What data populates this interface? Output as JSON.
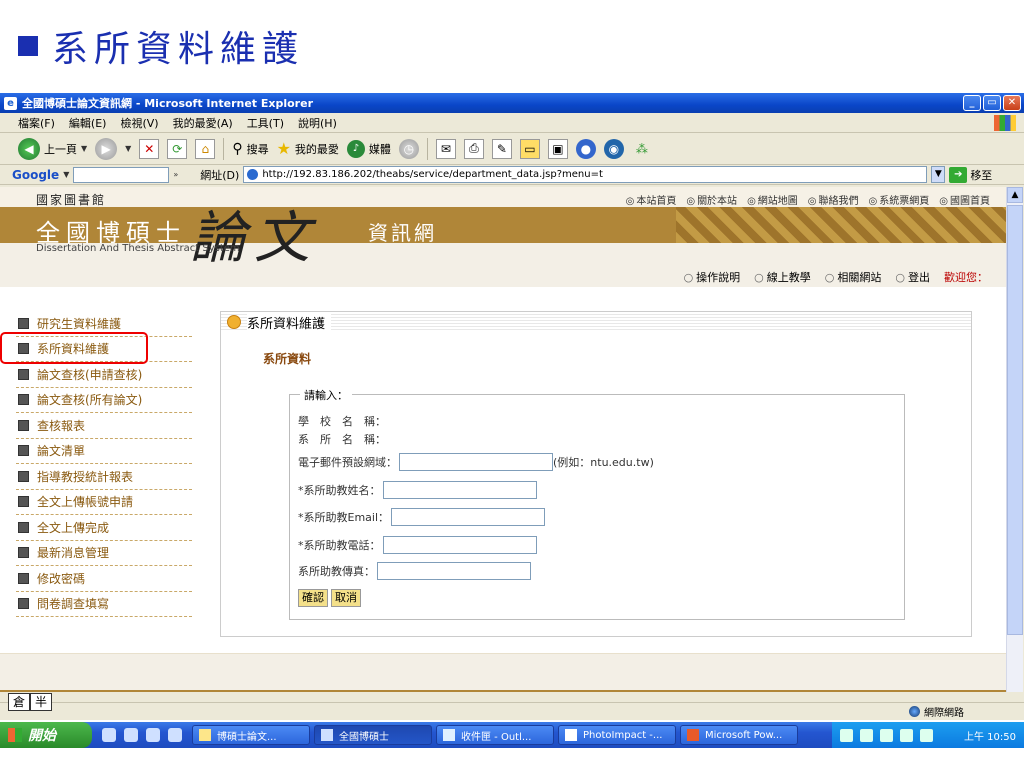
{
  "slide": {
    "title": "系所資料維護"
  },
  "window": {
    "title": "全國博碩士論文資訊網 - Microsoft Internet Explorer",
    "buttons": {
      "minimize": "_",
      "maximize": "▭",
      "close": "✕"
    }
  },
  "menubar": [
    "檔案(F)",
    "編輯(E)",
    "檢視(V)",
    "我的最愛(A)",
    "工具(T)",
    "說明(H)"
  ],
  "toolbar": {
    "back": "上一頁",
    "search": "搜尋",
    "favorites": "我的最愛",
    "media": "媒體"
  },
  "addressbar": {
    "google": "Google",
    "label": "網址(D)",
    "url": "http://192.83.186.202/theabs/service/department_data.jsp?menu=t",
    "go": "移至"
  },
  "site": {
    "library": "國家圖書館",
    "top_nav": [
      "本站首頁",
      "關於本站",
      "網站地圖",
      "聯絡我們",
      "系統票網頁",
      "國圖首頁"
    ],
    "name": "全國博碩士",
    "name_en": "Dissertation And Thesis Abstract  System",
    "lunwen": "論文",
    "subtitle": "資訊網",
    "sub_nav": [
      "操作說明",
      "線上教學",
      "相關網站",
      "登出"
    ],
    "welcome": "歡迎您："
  },
  "sidebar": {
    "items": [
      "研究生資料維護",
      "系所資料維護",
      "論文查核(申請查核)",
      "論文查核(所有論文)",
      "查核報表",
      "論文清單",
      "指導教授統計報表",
      "全文上傳帳號申請",
      "全文上傳完成",
      "最新消息管理",
      "修改密碼",
      "問卷調查填寫"
    ]
  },
  "panel": {
    "header": "系所資料維護",
    "section_title": "系所資料",
    "legend": "請輸入：",
    "school_label": "學　校　名　稱：",
    "dept_label": "系　所　名　稱：",
    "email_domain_label": "電子郵件預設網域：",
    "email_domain_hint": "(例如：ntu.edu.tw)",
    "assistant_name_label": "*系所助教姓名：",
    "assistant_email_label": "*系所助教Email：",
    "assistant_phone_label": "*系所助教電話：",
    "assistant_fax_label": "系所助教傳真：",
    "confirm": "確認",
    "cancel": "取消"
  },
  "statusbar": {
    "zone": "網際網路"
  },
  "ime": [
    "倉",
    "半"
  ],
  "taskbar": {
    "start": "開始",
    "tasks": [
      "博碩士論文...",
      "全國博碩士",
      "收件匣 - Outl...",
      "PhotoImpact -...",
      "Microsoft Pow..."
    ],
    "clock": "上午 10:50"
  }
}
